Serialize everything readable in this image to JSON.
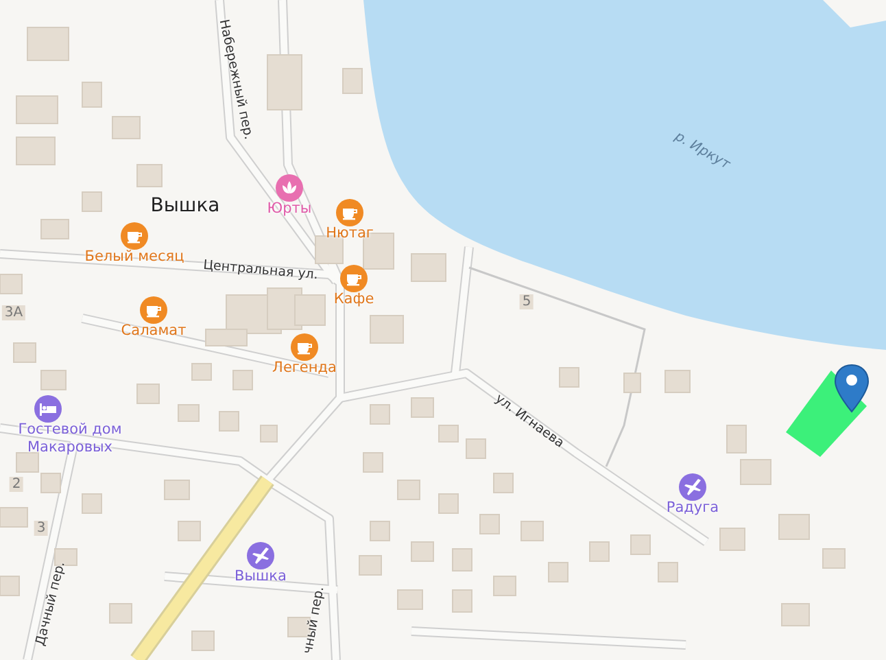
{
  "river": {
    "label": "р. Иркут"
  },
  "places": [
    {
      "kind": "locality",
      "label": "Вышка"
    },
    {
      "kind": "yurt",
      "label": "Юрты"
    },
    {
      "kind": "cafe",
      "label": "Нютаг"
    },
    {
      "kind": "cafe",
      "label": "Белый месяц"
    },
    {
      "kind": "cafe",
      "label": "Кафе"
    },
    {
      "kind": "cafe",
      "label": "Саламат"
    },
    {
      "kind": "cafe",
      "label": "Легенда"
    },
    {
      "kind": "hotel",
      "label": "Гостевой дом Макаровых"
    },
    {
      "kind": "airfield",
      "label": "Вышка"
    },
    {
      "kind": "airfield",
      "label": "Радуга"
    }
  ],
  "streets": [
    "Набережный пер.",
    "Центральная ул.",
    "ул. Игнаева",
    "Дачный пер.",
    "чный пер."
  ],
  "house_numbers": [
    "3А",
    "2",
    "3",
    "5"
  ]
}
